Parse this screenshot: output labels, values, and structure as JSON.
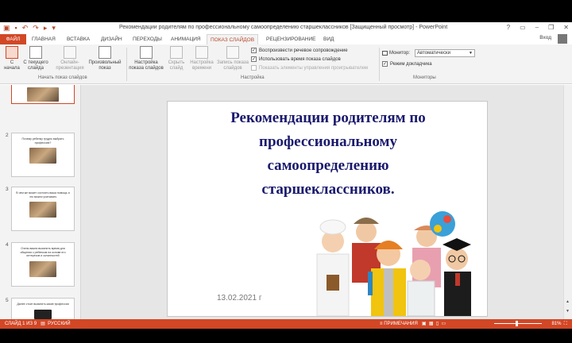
{
  "titlebar": {
    "title": "Рекомендации родителям по профессиональному самоопределению старшеклассников [Защищенный просмотр] - PowerPoint",
    "minimize": "–",
    "restore": "❐",
    "close": "✕",
    "help": "?"
  },
  "tabs": {
    "file": "ФАЙЛ",
    "items": [
      "ГЛАВНАЯ",
      "ВСТАВКА",
      "ДИЗАЙН",
      "ПЕРЕХОДЫ",
      "АНИМАЦИЯ",
      "ПОКАЗ СЛАЙДОВ",
      "РЕЦЕНЗИРОВАНИЕ",
      "ВИД"
    ],
    "active": "ПОКАЗ СЛАЙДОВ",
    "login": "Вход"
  },
  "ribbon": {
    "start_group": {
      "from_start": "С начала",
      "from_current_1": "С текущего",
      "from_current_2": "слайда",
      "online_1": "Онлайн-",
      "online_2": "презентация",
      "custom_1": "Произвольный",
      "custom_2": "показ",
      "label": "Начать показ слайдов"
    },
    "setup_group": {
      "setup_1": "Настройка",
      "setup_2": "показа слайдов",
      "hide_1": "Скрыть",
      "hide_2": "слайд",
      "rehearse_1": "Настройка",
      "rehearse_2": "времени",
      "record_1": "Запись показа",
      "record_2": "слайдов",
      "play_narrations": "Воспроизвести речевое сопровождение",
      "use_timings": "Использовать время показа слайдов",
      "show_controls": "Показать элементы управления проигрывателем",
      "label": "Настройка"
    },
    "monitors_group": {
      "monitor_label": "Монитор:",
      "monitor_value": "Автоматически",
      "presenter_view": "Режим докладчика",
      "label": "Мониторы"
    }
  },
  "thumbnails": [
    {
      "num": "2",
      "text": "Почему ребенку трудно выбрать профессию?"
    },
    {
      "num": "3",
      "text": "В чем же может состоять ваша помощь и что можно учитывать"
    },
    {
      "num": "4",
      "text": "Очень важно выяснить время для общения с ребенком на основе его интересов и склонностей"
    },
    {
      "num": "5",
      "text": "Далее стоит выяснить какие профессии"
    }
  ],
  "slide": {
    "title_line1": "Рекомендации родителям по",
    "title_line2": "профессиональному",
    "title_line3": "самоопределению",
    "title_line4": "старшеклассников.",
    "date": "13.02.2021 г"
  },
  "statusbar": {
    "slide_info": "СЛАЙД 1 ИЗ 9",
    "language": "РУССКИЙ",
    "notes": "ПРИМЕЧАНИЯ",
    "zoom": "81%"
  },
  "colors": {
    "accent": "#d24726",
    "title_navy": "#1a1a6e"
  }
}
